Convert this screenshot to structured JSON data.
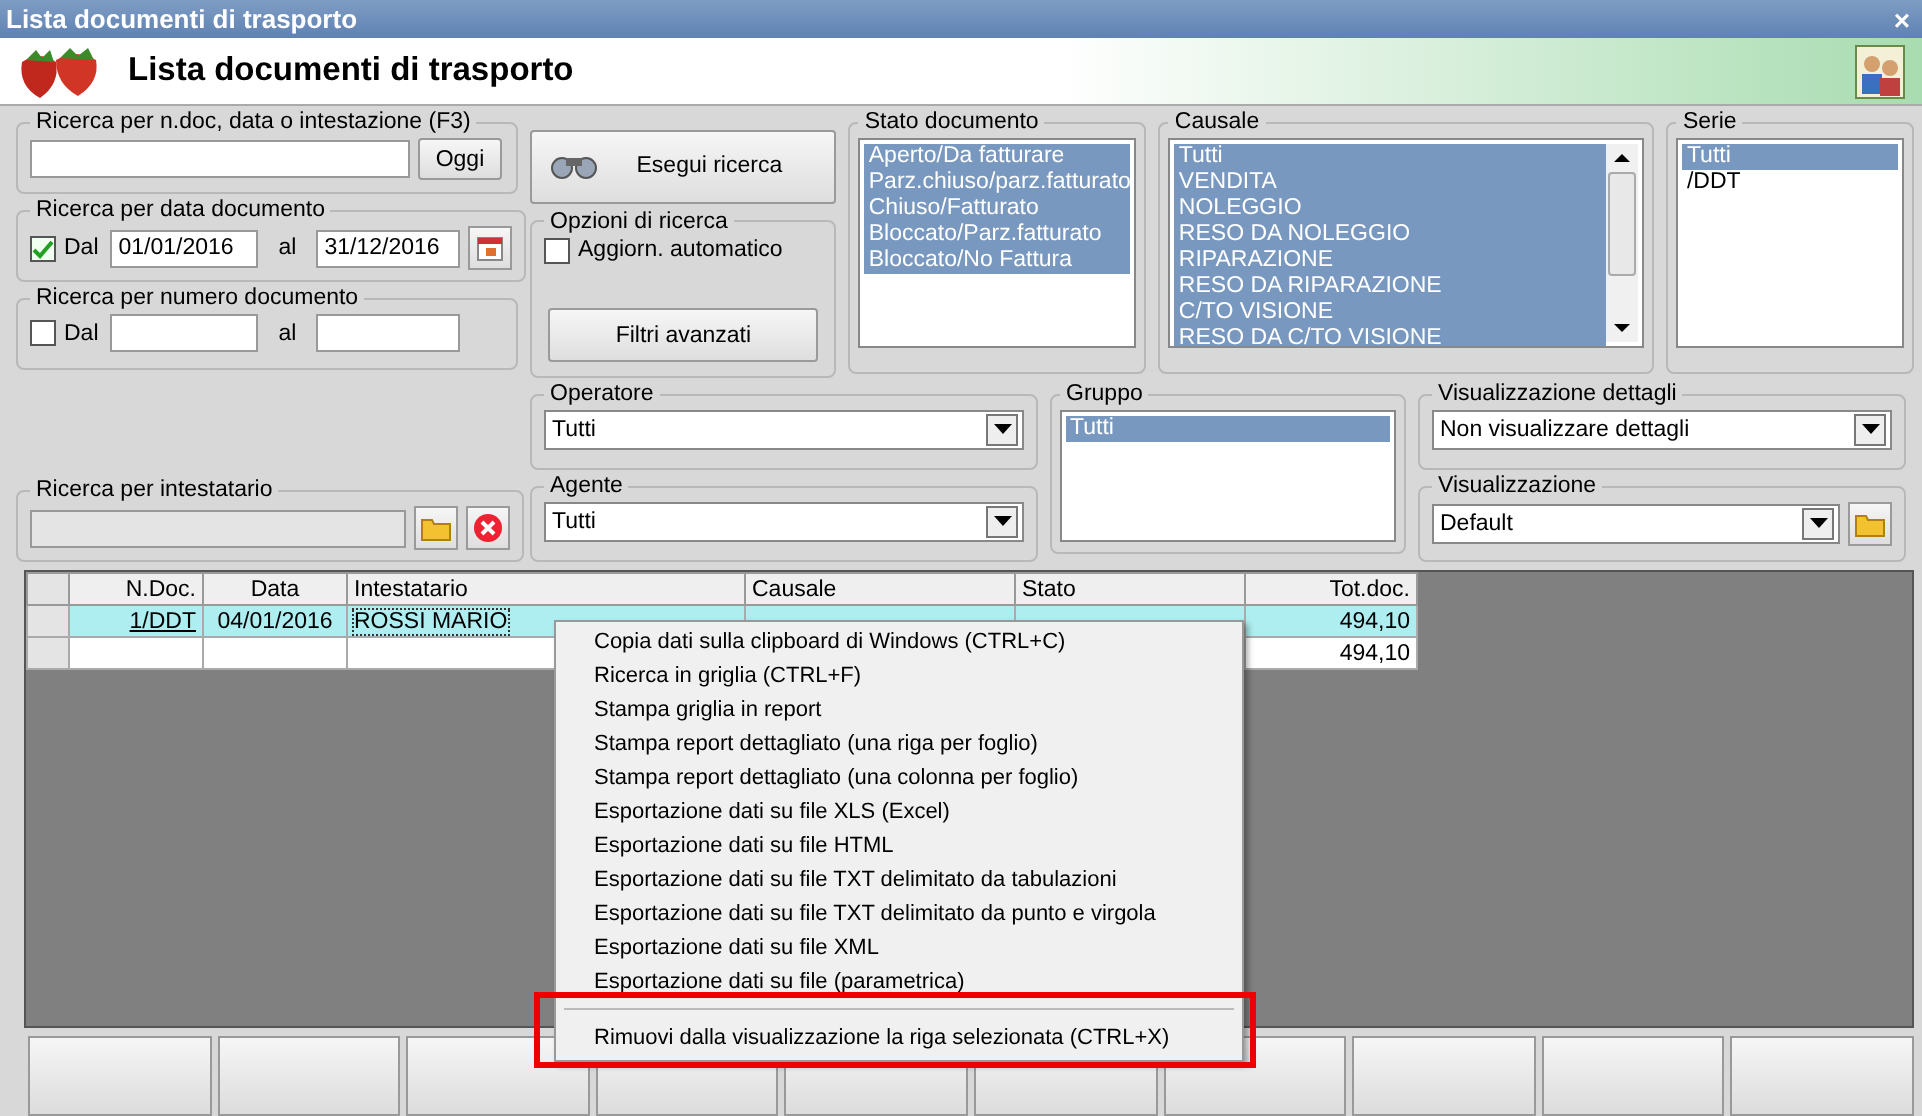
{
  "window": {
    "title": "Lista documenti di trasporto",
    "close": "×"
  },
  "header": {
    "title": "Lista documenti di trasporto"
  },
  "search_box": {
    "label": "Ricerca per n.doc, data o intestazione (F3)",
    "button": "Oggi"
  },
  "date_search": {
    "label": "Ricerca per data documento",
    "checked": true,
    "from_label": "Dal",
    "from": "01/01/2016",
    "to_label": "al",
    "to": "31/12/2016"
  },
  "number_search": {
    "label": "Ricerca per numero documento",
    "checked": false,
    "from_label": "Dal",
    "to_label": "al"
  },
  "search_button": "Esegui ricerca",
  "options": {
    "label": "Opzioni di ricerca",
    "auto_update": {
      "label": "Aggiorn. automatico",
      "checked": false
    },
    "advanced_button": "Filtri avanzati"
  },
  "status_list": {
    "label": "Stato documento",
    "items": [
      {
        "label": "Aperto/Da fatturare",
        "selected": true
      },
      {
        "label": "Parz.chiuso/parz.fatturato",
        "selected": true
      },
      {
        "label": "Chiuso/Fatturato",
        "selected": true
      },
      {
        "label": "Bloccato/Parz.fatturato",
        "selected": true
      },
      {
        "label": "Bloccato/No Fattura",
        "selected": true
      }
    ]
  },
  "causale_list": {
    "label": "Causale",
    "items": [
      {
        "label": "Tutti",
        "selected": true
      },
      {
        "label": "VENDITA",
        "selected": true
      },
      {
        "label": "NOLEGGIO",
        "selected": true
      },
      {
        "label": "RESO DA NOLEGGIO",
        "selected": true
      },
      {
        "label": "RIPARAZIONE",
        "selected": true
      },
      {
        "label": "RESO DA RIPARAZIONE",
        "selected": true
      },
      {
        "label": "C/TO VISIONE",
        "selected": true
      },
      {
        "label": "RESO DA C/TO VISIONE",
        "selected": true
      }
    ]
  },
  "serie_list": {
    "label": "Serie",
    "items": [
      {
        "label": "Tutti",
        "selected": true
      },
      {
        "label": "/DDT",
        "selected": false
      }
    ]
  },
  "owner_search": {
    "label": "Ricerca per intestatario"
  },
  "operatore": {
    "label": "Operatore",
    "value": "Tutti"
  },
  "agente": {
    "label": "Agente",
    "value": "Tutti"
  },
  "gruppo": {
    "label": "Gruppo",
    "items": [
      {
        "label": "Tutti",
        "selected": true
      }
    ]
  },
  "details_view": {
    "label": "Visualizzazione dettagli",
    "value": "Non visualizzare dettagli"
  },
  "view": {
    "label": "Visualizzazione",
    "value": "Default"
  },
  "table": {
    "columns": [
      "N.Doc.",
      "Data",
      "Intestatario",
      "Causale",
      "Stato",
      "Tot.doc."
    ],
    "rows": [
      {
        "cells": [
          "1/DDT",
          "04/01/2016",
          "ROSSI MARIO"
        ],
        "total": "494,10",
        "selected": true
      },
      {
        "total": "494,10",
        "selected": false
      }
    ]
  },
  "context_menu": {
    "items": [
      {
        "kind": "item",
        "label": "Copia dati sulla clipboard di Windows (CTRL+C)",
        "marked": false
      },
      {
        "kind": "item",
        "label": "Ricerca in griglia (CTRL+F)",
        "marked": false
      },
      {
        "kind": "item",
        "label": "Stampa griglia in report",
        "marked": false
      },
      {
        "kind": "item",
        "label": "Stampa report dettagliato (una riga per foglio)",
        "marked": false
      },
      {
        "kind": "item",
        "label": "Stampa report dettagliato (una colonna per foglio)",
        "marked": false
      },
      {
        "kind": "item",
        "label": "Esportazione dati su file XLS (Excel)",
        "marked": false
      },
      {
        "kind": "item",
        "label": "Esportazione dati su file HTML",
        "marked": false
      },
      {
        "kind": "item",
        "label": "Esportazione dati su file TXT delimitato da tabulazioni",
        "marked": false
      },
      {
        "kind": "item",
        "label": "Esportazione dati su file TXT delimitato da punto e virgola",
        "marked": false
      },
      {
        "kind": "item",
        "label": "Esportazione dati su file XML",
        "marked": false
      },
      {
        "kind": "item",
        "label": "Esportazione dati su file (parametrica)",
        "marked": false
      },
      {
        "kind": "separator"
      },
      {
        "kind": "item",
        "label": "Rimuovi dalla visualizzazione la riga selezionata (CTRL+X)",
        "marked": true
      }
    ]
  }
}
